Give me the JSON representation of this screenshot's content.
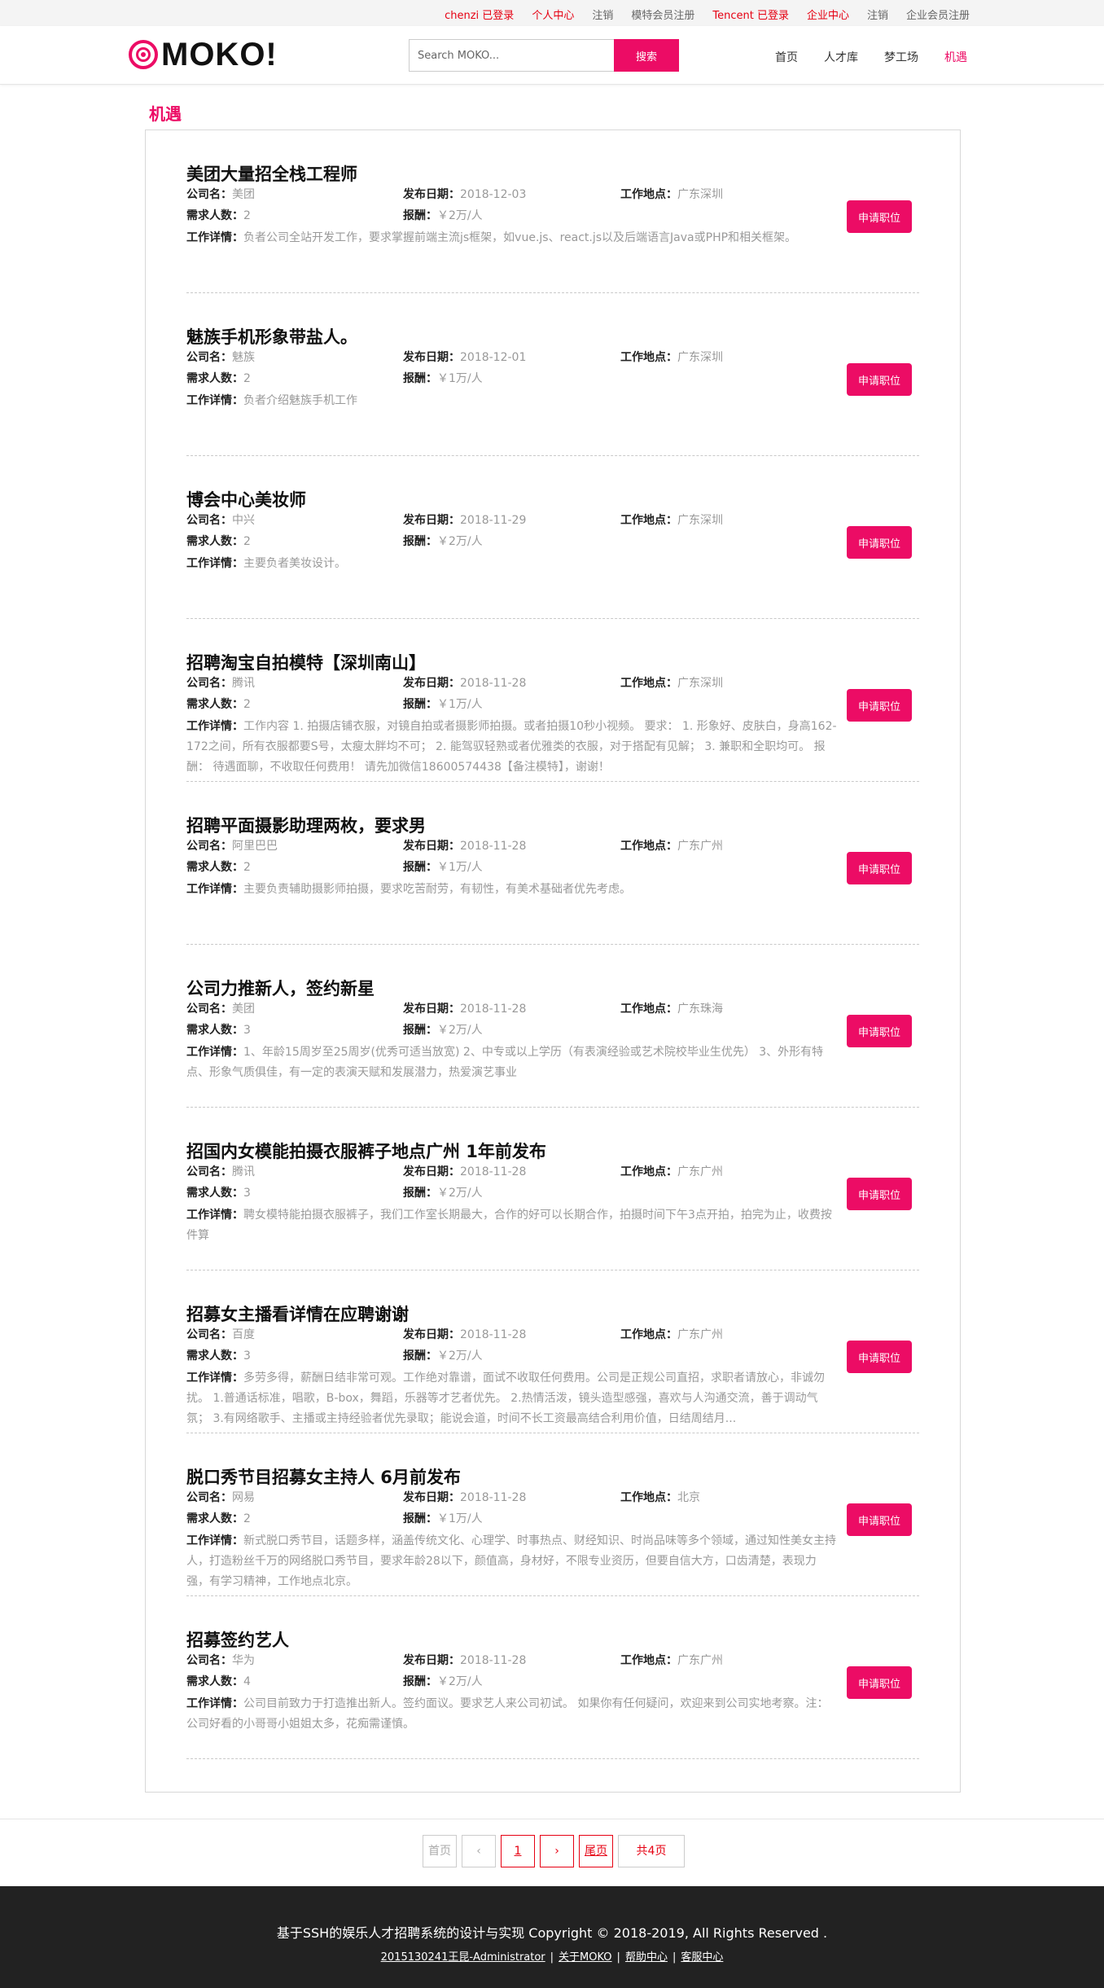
{
  "topbar": {
    "user1": "chenzi 已登录",
    "personal": "个人中心",
    "logout1": "注销",
    "model_register": "模特会员注册",
    "user2": "Tencent 已登录",
    "enterprise": "企业中心",
    "logout2": "注销",
    "enterprise_register": "企业会员注册"
  },
  "header": {
    "logo_text": "MOKO!",
    "search_placeholder": "Search MOKO...",
    "search_button": "搜索",
    "nav": [
      "首页",
      "人才库",
      "梦工场",
      "机遇"
    ]
  },
  "section_title": "机遇",
  "labels": {
    "company": "公司名：",
    "date": "发布日期：",
    "location": "工作地点：",
    "count": "需求人数：",
    "pay": "报酬：",
    "detail": "工作详情：",
    "apply": "申请职位"
  },
  "jobs": [
    {
      "title": "美团大量招全栈工程师",
      "company": "美团",
      "date": "2018-12-03",
      "location": "广东深圳",
      "count": "2",
      "pay": "￥2万/人",
      "detail": "负者公司全站开发工作，要求掌握前端主流js框架，如vue.js、react.js以及后端语言Java或PHP和相关框架。"
    },
    {
      "title": "魅族手机形象带盐人。",
      "company": "魅族",
      "date": "2018-12-01",
      "location": "广东深圳",
      "count": "2",
      "pay": "￥1万/人",
      "detail": "负者介绍魅族手机工作"
    },
    {
      "title": "博会中心美妆师",
      "company": "中兴",
      "date": "2018-11-29",
      "location": "广东深圳",
      "count": "2",
      "pay": "￥2万/人",
      "detail": "主要负者美妆设计。"
    },
    {
      "title": "招聘淘宝自拍模特【深圳南山】",
      "company": "腾讯",
      "date": "2018-11-28",
      "location": "广东深圳",
      "count": "2",
      "pay": "￥1万/人",
      "detail": "工作内容 1. 拍摄店铺衣服，对镜自拍或者摄影师拍摄。或者拍摄10秒小视频。 要求： 1. 形象好、皮肤白，身高162-172之间，所有衣服都要S号，太瘦太胖均不可； 2. 能驾驭轻熟或者优雅类的衣服，对于搭配有见解； 3. 兼职和全职均可。 报酬： 待遇面聊，不收取任何费用！ 请先加微信18600574438【备注模特】，谢谢！"
    },
    {
      "title": "招聘平面摄影助理两枚，要求男",
      "company": "阿里巴巴",
      "date": "2018-11-28",
      "location": "广东广州",
      "count": "2",
      "pay": "￥1万/人",
      "detail": "主要负责辅助摄影师拍摄，要求吃苦耐劳，有韧性，有美术基础者优先考虑。"
    },
    {
      "title": "公司力推新人，签约新星",
      "company": "美团",
      "date": "2018-11-28",
      "location": "广东珠海",
      "count": "3",
      "pay": "￥2万/人",
      "detail": "1、年龄15周岁至25周岁(优秀可适当放宽) 2、中专或以上学历（有表演经验或艺术院校毕业生优先） 3、外形有特点、形象气质俱佳，有一定的表演天赋和发展潜力，热爱演艺事业"
    },
    {
      "title": "招国内女模能拍摄衣服裤子地点广州 1年前发布",
      "company": "腾讯",
      "date": "2018-11-28",
      "location": "广东广州",
      "count": "3",
      "pay": "￥2万/人",
      "detail": "聘女模特能拍摄衣服裤子，我们工作室长期最大，合作的好可以长期合作，拍摄时间下午3点开拍，拍完为止，收费按件算"
    },
    {
      "title": "招募女主播看详情在应聘谢谢",
      "company": "百度",
      "date": "2018-11-28",
      "location": "广东广州",
      "count": "3",
      "pay": "￥2万/人",
      "detail": "多劳多得，薪酬日结非常可观。工作绝对靠谱，面试不收取任何费用。公司是正规公司直招，求职者请放心，非诚勿扰。 1.普通话标准，唱歌，B-box，舞蹈，乐器等才艺者优先。 2.热情活泼，镜头造型感强，喜欢与人沟通交流，善于调动气氛； 3.有网络歌手、主播或主持经验者优先录取；能说会道，时间不长工资最高结合利用价值，日结周结月..."
    },
    {
      "title": "脱口秀节目招募女主持人 6月前发布",
      "company": "网易",
      "date": "2018-11-28",
      "location": "北京",
      "count": "2",
      "pay": "￥1万/人",
      "detail": "新式脱口秀节目，话题多样，涵盖传统文化、心理学、时事热点、财经知识、时尚品味等多个领域，通过知性美女主持人，打造粉丝千万的网络脱口秀节目，要求年龄28以下，颜值高，身材好，不限专业资历，但要自信大方，口齿清楚，表现力强，有学习精神，工作地点北京。"
    },
    {
      "title": "招募签约艺人",
      "company": "华为",
      "date": "2018-11-28",
      "location": "广东广州",
      "count": "4",
      "pay": "￥2万/人",
      "detail": "公司目前致力于打造推出新人。签约面议。要求艺人来公司初试。 如果你有任何疑问，欢迎来到公司实地考察。注：公司好看的小哥哥小姐姐太多，花痴需谨慎。"
    }
  ],
  "pagination": {
    "first": "首页",
    "prev": "‹",
    "current": "1",
    "next": "›",
    "last": "尾页",
    "total": "共4页"
  },
  "footer": {
    "copyright": "基于SSH的娱乐人才招聘系统的设计与实现 Copyright © 2018-2019, All Rights Reserved .",
    "links": [
      "2015130241王昆-Administrator",
      "关于MOKO",
      "帮助中心",
      "客服中心"
    ]
  },
  "colors": {
    "accent": "#ec0c65",
    "footer_bg": "#222222",
    "topbar_red": "#e60012"
  }
}
